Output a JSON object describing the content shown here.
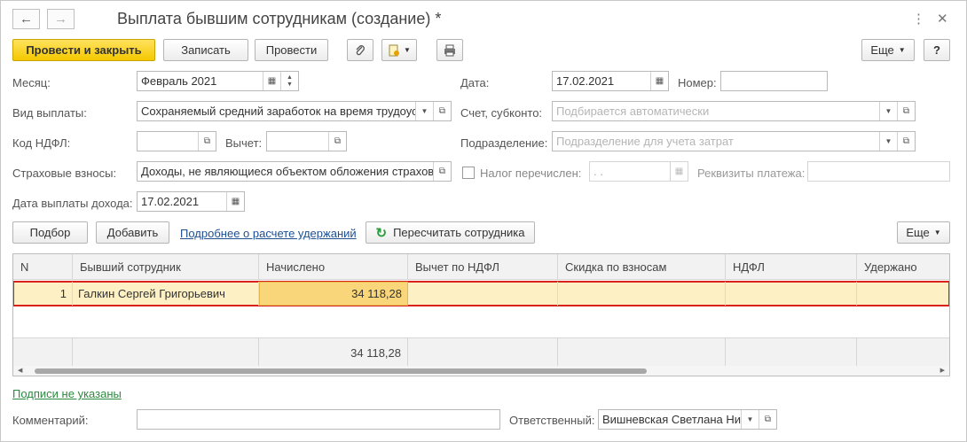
{
  "window": {
    "title": "Выплата бывшим сотрудникам (создание) *",
    "nav_back_icon": "arrow-left-icon",
    "nav_forward_icon": "arrow-right-icon"
  },
  "toolbar": {
    "post_close": "Провести и закрыть",
    "save": "Записать",
    "post": "Провести",
    "more": "Еще",
    "help": "?"
  },
  "form": {
    "month_label": "Месяц:",
    "month_value": "Февраль 2021",
    "payment_type_label": "Вид выплаты:",
    "payment_type_value": "Сохраняемый средний заработок на время трудоустройства",
    "ndfl_code_label": "Код НДФЛ:",
    "ndfl_code_value": "",
    "deduction_label": "Вычет:",
    "deduction_value": "",
    "insurance_label": "Страховые взносы:",
    "insurance_value": "Доходы, не являющиеся объектом обложения страховыми взносами",
    "income_date_label": "Дата выплаты дохода:",
    "income_date_value": "17.02.2021",
    "date_label": "Дата:",
    "date_value": "17.02.2021",
    "number_label": "Номер:",
    "number_value": "",
    "account_label": "Счет, субконто:",
    "account_placeholder": "Подбирается автоматически",
    "dept_label": "Подразделение:",
    "dept_placeholder": "Подразделение для учета затрат",
    "tax_transferred_label": "Налог перечислен:",
    "tax_date_value": " .  .",
    "payment_details_label": "Реквизиты платежа:"
  },
  "table_toolbar": {
    "pick": "Подбор",
    "add": "Добавить",
    "details_link": "Подробнее о расчете удержаний",
    "recalc": "Пересчитать сотрудника",
    "more": "Еще"
  },
  "table": {
    "headers": [
      "N",
      "Бывший сотрудник",
      "Начислено",
      "Вычет по НДФЛ",
      "Скидка по взносам",
      "НДФЛ",
      "Удержано"
    ],
    "rows": [
      {
        "n": "1",
        "employee": "Галкин Сергей Григорьевич",
        "accrued": "34 118,28",
        "deduction": "",
        "discount": "",
        "ndfl": "",
        "withheld": ""
      }
    ],
    "footer_accrued": "34 118,28"
  },
  "bottom": {
    "signatures_link": "Подписи не указаны",
    "comment_label": "Комментарий:",
    "comment_value": "",
    "responsible_label": "Ответственный:",
    "responsible_value": "Вишневская Светлана Николаевна"
  }
}
